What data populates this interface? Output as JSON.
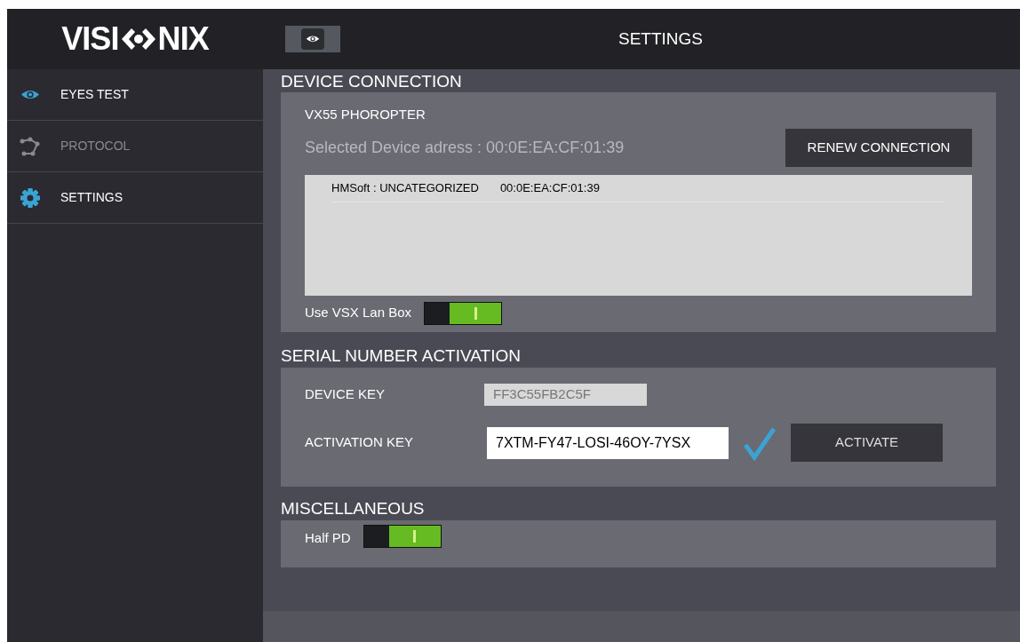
{
  "logo": {
    "left": "VISI",
    "right": "NIX"
  },
  "header": {
    "title": "SETTINGS"
  },
  "sidebar": {
    "items": [
      {
        "label": "EYES TEST",
        "kind": "eye",
        "disabled": false
      },
      {
        "label": "PROTOCOL",
        "kind": "protocol",
        "disabled": true
      },
      {
        "label": "SETTINGS",
        "kind": "gear",
        "disabled": false
      }
    ]
  },
  "device_connection": {
    "title": "DEVICE CONNECTION",
    "device_name": "VX55 PHOROPTER",
    "selected_address": "Selected Device adress : 00:0E:EA:CF:01:39",
    "renew_button": "RENEW CONNECTION",
    "devices": [
      {
        "name": "HMSoft : UNCATEGORIZED",
        "address": "00:0E:EA:CF:01:39"
      }
    ],
    "lan_box": {
      "label": "Use VSX Lan Box",
      "on": true
    }
  },
  "serial": {
    "title": "SERIAL NUMBER ACTIVATION",
    "device_key_label": "DEVICE KEY",
    "device_key": "FF3C55FB2C5F",
    "activation_key_label": "ACTIVATION KEY",
    "activation_key": "7XTM-FY47-LOSI-46OY-7YSX",
    "valid": true,
    "activate_button": "ACTIVATE"
  },
  "misc": {
    "title": "MISCELLANEOUS",
    "half_pd": {
      "label": "Half PD",
      "on": true
    }
  }
}
